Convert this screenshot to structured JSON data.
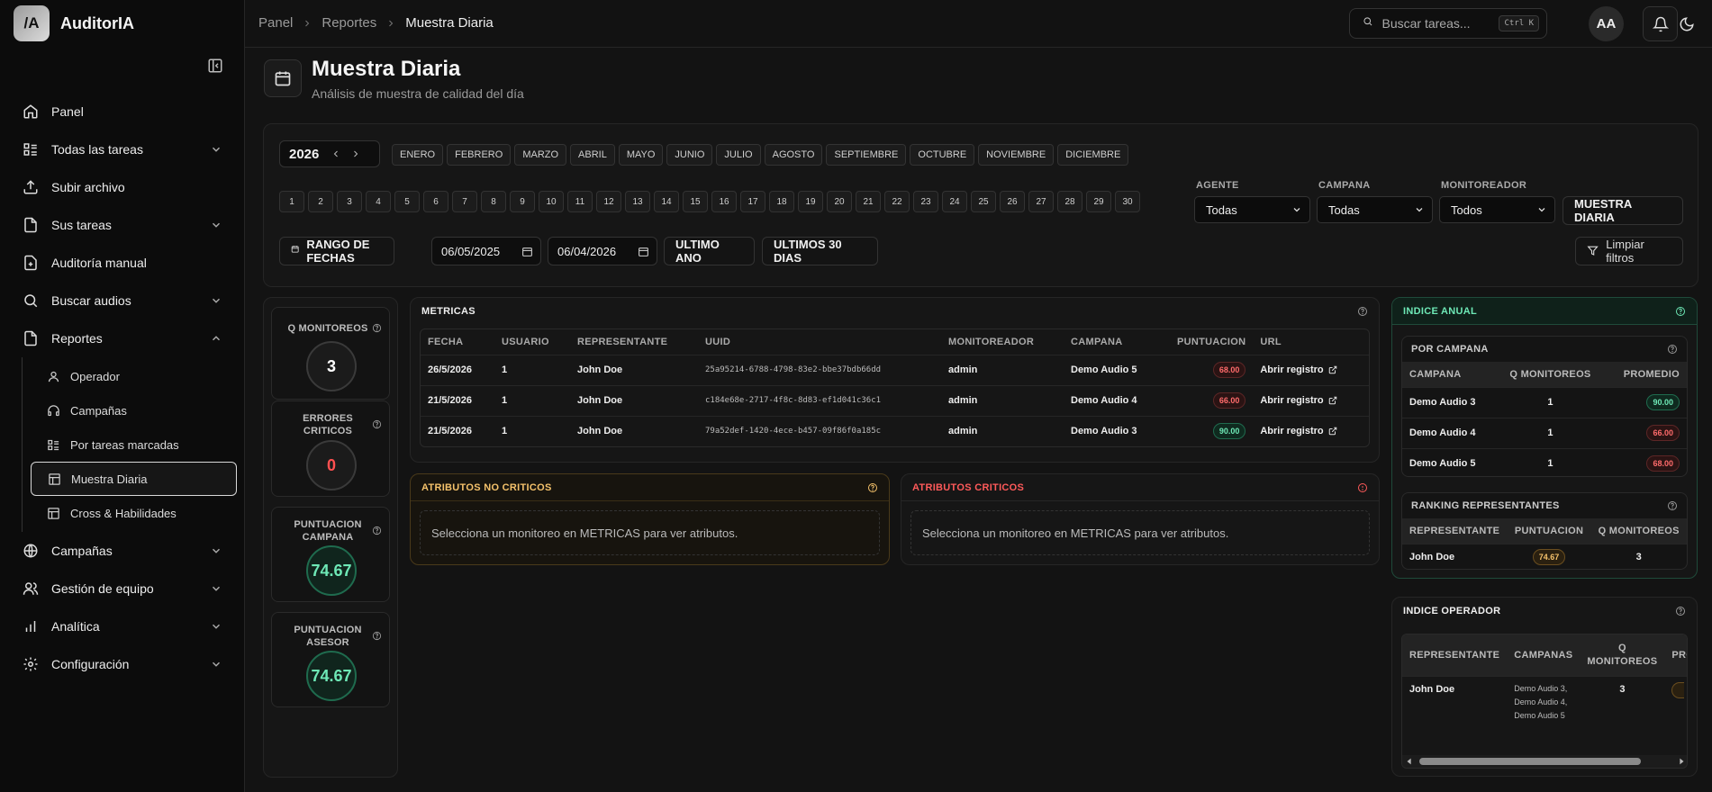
{
  "brand": {
    "name": "AuditorIA",
    "logo_text": "/A"
  },
  "sidebar": {
    "items": [
      {
        "label": "Panel",
        "icon": "home-icon",
        "has_chevron": false
      },
      {
        "label": "Todas las tareas",
        "icon": "list-icon",
        "has_chevron": true
      },
      {
        "label": "Subir archivo",
        "icon": "upload-icon",
        "has_chevron": false
      },
      {
        "label": "Sus tareas",
        "icon": "file-icon",
        "has_chevron": true
      },
      {
        "label": "Auditoría manual",
        "icon": "file-plus-icon",
        "has_chevron": false
      },
      {
        "label": "Buscar audios",
        "icon": "search-icon",
        "has_chevron": true
      },
      {
        "label": "Reportes",
        "icon": "file-text-icon",
        "has_chevron": true,
        "expanded": true
      }
    ],
    "reportes_sub": [
      {
        "label": "Operador",
        "icon": "user-icon"
      },
      {
        "label": "Campañas",
        "icon": "headset-icon"
      },
      {
        "label": "Por tareas marcadas",
        "icon": "list-icon"
      },
      {
        "label": "Muestra Diaria",
        "icon": "table-icon",
        "active": true
      },
      {
        "label": "Cross & Habilidades",
        "icon": "table-icon"
      }
    ],
    "items_after": [
      {
        "label": "Campañas",
        "icon": "globe-icon"
      },
      {
        "label": "Gestión de equipo",
        "icon": "users-icon"
      },
      {
        "label": "Analítica",
        "icon": "bar-chart-icon"
      },
      {
        "label": "Configuración",
        "icon": "gear-icon"
      }
    ]
  },
  "breadcrumb": {
    "items": [
      "Panel",
      "Reportes"
    ],
    "current": "Muestra Diaria"
  },
  "search": {
    "placeholder": "Buscar tareas...",
    "shortcut": "Ctrl K"
  },
  "user": {
    "initials": "AA"
  },
  "page": {
    "title": "Muestra Diaria",
    "subtitle": "Análisis de muestra de calidad del día"
  },
  "filters": {
    "year": "2026",
    "months": [
      "ENERO",
      "FEBRERO",
      "MARZO",
      "ABRIL",
      "MAYO",
      "JUNIO",
      "JULIO",
      "AGOSTO",
      "SEPTIEMBRE",
      "OCTUBRE",
      "NOVIEMBRE",
      "DICIEMBRE"
    ],
    "days": [
      "1",
      "2",
      "3",
      "4",
      "5",
      "6",
      "7",
      "8",
      "9",
      "10",
      "11",
      "12",
      "13",
      "14",
      "15",
      "16",
      "17",
      "18",
      "19",
      "20",
      "21",
      "22",
      "23",
      "24",
      "25",
      "26",
      "27",
      "28",
      "29",
      "30"
    ],
    "agente_label": "AGENTE",
    "agente_value": "Todas",
    "campana_label": "CAMPANA",
    "campana_value": "Todas",
    "monitoreador_label": "MONITOREADOR",
    "monitoreador_value": "Todos",
    "muestra_btn": "MUESTRA DIARIA",
    "rango_btn": "RANGO DE FECHAS",
    "date_from": "06/05/2025",
    "date_to": "06/04/2026",
    "ultimo_ano_btn": "ULTIMO ANO",
    "ultimos30_btn": "ULTIMOS 30 DIAS",
    "limpiar_btn": "Limpiar filtros"
  },
  "stats": {
    "q_monitoreos": {
      "label": "Q MONITOREOS",
      "value": "3"
    },
    "errores": {
      "label": "ERRORES CRITICOS",
      "value": "0"
    },
    "punt_campana": {
      "label": "PUNTUACION CAMPANA",
      "value": "74.67"
    },
    "punt_asesor": {
      "label": "PUNTUACION ASESOR",
      "value": "74.67"
    }
  },
  "metricas": {
    "title": "METRICAS",
    "headers": [
      "FECHA",
      "USUARIO",
      "REPRESENTANTE",
      "UUID",
      "MONITOREADOR",
      "CAMPANA",
      "PUNTUACION",
      "URL"
    ],
    "rows": [
      {
        "fecha": "26/5/2026",
        "usuario": "1",
        "representante": "John Doe",
        "uuid": "25a95214-6788-4798-83e2-bbe37bdb66dd",
        "monitoreador": "admin",
        "campana": "Demo Audio 5",
        "puntuacion": "68.00",
        "status": "red",
        "url": "Abrir registro"
      },
      {
        "fecha": "21/5/2026",
        "usuario": "1",
        "representante": "John Doe",
        "uuid": "c184e68e-2717-4f8c-8d83-ef1d041c36c1",
        "monitoreador": "admin",
        "campana": "Demo Audio 4",
        "puntuacion": "66.00",
        "status": "red",
        "url": "Abrir registro"
      },
      {
        "fecha": "21/5/2026",
        "usuario": "1",
        "representante": "John Doe",
        "uuid": "79a52def-1420-4ece-b457-09f86f0a185c",
        "monitoreador": "admin",
        "campana": "Demo Audio 3",
        "puntuacion": "90.00",
        "status": "green",
        "url": "Abrir registro"
      }
    ]
  },
  "atributos_no_criticos": {
    "title": "ATRIBUTOS NO CRITICOS",
    "empty": "Selecciona un monitoreo en METRICAS para ver atributos."
  },
  "atributos_criticos": {
    "title": "ATRIBUTOS CRITICOS",
    "empty": "Selecciona un monitoreo en METRICAS para ver atributos."
  },
  "indice_anual": {
    "title": "INDICE ANUAL",
    "por_campana": {
      "title": "POR CAMPANA",
      "headers": [
        "CAMPANA",
        "Q MONITOREOS",
        "PROMEDIO"
      ],
      "rows": [
        {
          "campana": "Demo Audio 3",
          "q": "1",
          "promedio": "90.00",
          "status": "green"
        },
        {
          "campana": "Demo Audio 4",
          "q": "1",
          "promedio": "66.00",
          "status": "red"
        },
        {
          "campana": "Demo Audio 5",
          "q": "1",
          "promedio": "68.00",
          "status": "red"
        }
      ]
    },
    "ranking": {
      "title": "RANKING REPRESENTANTES",
      "headers": [
        "REPRESENTANTE",
        "PUNTUACION",
        "Q MONITOREOS"
      ],
      "rows": [
        {
          "representante": "John Doe",
          "puntuacion": "74.67",
          "q": "3"
        }
      ]
    }
  },
  "indice_operador": {
    "title": "INDICE OPERADOR",
    "headers": [
      "REPRESENTANTE",
      "CAMPANAS",
      "Q MONITOREOS",
      "PROI"
    ],
    "rows": [
      {
        "representante": "John Doe",
        "campanas": "Demo Audio 3, Demo Audio 4, Demo Audio 5",
        "q": "3"
      }
    ]
  },
  "colors": {
    "accent_green": "#6ee8b6",
    "accent_red": "#ff6b6b",
    "accent_amber": "#f5c26b"
  }
}
